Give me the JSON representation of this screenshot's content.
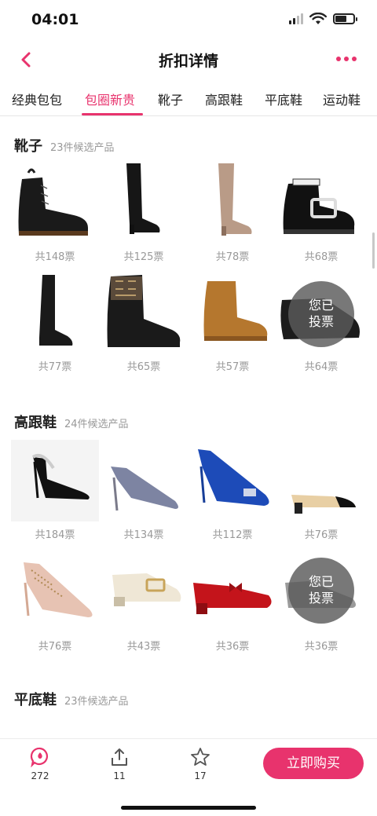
{
  "status": {
    "time": "04:01"
  },
  "nav": {
    "title": "折扣详情"
  },
  "tabs": [
    "经典包包",
    "包圈新贵",
    "靴子",
    "高跟鞋",
    "平底鞋",
    "运动鞋"
  ],
  "sections": [
    {
      "name": "靴子",
      "count": "23件候选产品",
      "items": [
        {
          "votes": "共148票",
          "icon": "combat-boot-icon"
        },
        {
          "votes": "共125票",
          "icon": "over-knee-boot-icon"
        },
        {
          "votes": "共78票",
          "icon": "tan-thigh-boot-icon"
        },
        {
          "votes": "共68票",
          "icon": "buckle-ankle-boot-icon"
        },
        {
          "votes": "共77票",
          "icon": "knee-boot-icon"
        },
        {
          "votes": "共65票",
          "icon": "sock-boot-icon"
        },
        {
          "votes": "共57票",
          "icon": "sheepskin-boot-icon"
        },
        {
          "votes": "共64票",
          "icon": "black-loafer-icon",
          "voted": true
        }
      ]
    },
    {
      "name": "高跟鞋",
      "count": "24件候选产品",
      "items": [
        {
          "votes": "共184票",
          "icon": "slingback-pump-icon"
        },
        {
          "votes": "共134票",
          "icon": "glitter-pump-icon"
        },
        {
          "votes": "共112票",
          "icon": "blue-satin-pump-icon"
        },
        {
          "votes": "共76票",
          "icon": "two-tone-slingback-icon"
        },
        {
          "votes": "共76票",
          "icon": "studded-heel-icon"
        },
        {
          "votes": "共43票",
          "icon": "cream-loafer-icon"
        },
        {
          "votes": "共36票",
          "icon": "red-bow-pump-icon"
        },
        {
          "votes": "共36票",
          "icon": "metallic-shoe-icon",
          "voted": true
        }
      ]
    },
    {
      "name": "平底鞋",
      "count": "23件候选产品"
    }
  ],
  "voted_label": {
    "line1": "您已",
    "line2": "投票"
  },
  "bottom": {
    "comments": "272",
    "shares": "11",
    "favorites": "17",
    "buy": "立即购买"
  },
  "colors": {
    "accent": "#e8336d"
  }
}
